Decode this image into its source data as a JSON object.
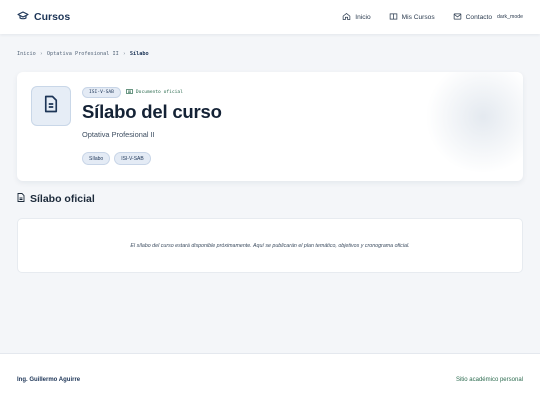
{
  "header": {
    "brand": "Cursos",
    "nav": [
      {
        "label": "Inicio",
        "icon": "home-icon"
      },
      {
        "label": "Mis Cursos",
        "icon": "book-icon"
      },
      {
        "label": "Contacto",
        "icon": "mail-icon"
      }
    ],
    "dark_mode": "dark_mode"
  },
  "breadcrumb": {
    "items": [
      "Inicio",
      "Optativa Profesional II",
      "Sílabo"
    ],
    "separator": "›"
  },
  "hero": {
    "code": "ISI-V-SAB",
    "badge": "Documento oficial",
    "title": "Sílabo del curso",
    "subtitle": "Optativa Profesional II",
    "chips": [
      "Sílabo",
      "ISI-V-SAB"
    ]
  },
  "section": {
    "title": "Sílabo oficial"
  },
  "notice": {
    "text": "El sílabo del curso estará disponible próximamente. Aquí se publicarán el plan temático, objetivos y cronograma oficial."
  },
  "footer": {
    "author": "Ing. Guillermo Aguirre",
    "site": "Sitio académico personal"
  },
  "colors": {
    "brand": "#1d3557",
    "accent_green": "#2c6b4f",
    "background": "#f4f6f9"
  }
}
